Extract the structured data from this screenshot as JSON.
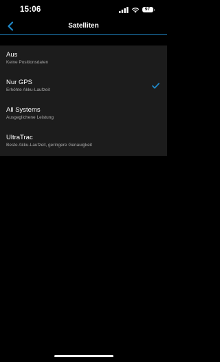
{
  "status_bar": {
    "time": "15:06",
    "battery": "97"
  },
  "nav": {
    "title": "Satelliten",
    "accent_color": "#1f88c8"
  },
  "options": [
    {
      "label": "Aus",
      "description": "Keine Positionsdaten",
      "selected": false
    },
    {
      "label": "Nur GPS",
      "description": "Erhöhte Akku-Laufzeit",
      "selected": true
    },
    {
      "label": "All Systems",
      "description": "Ausgeglichene Leistung",
      "selected": false
    },
    {
      "label": "UltraTrac",
      "description": "Beste Akku-Laufzeit, geringere Genauigkeit",
      "selected": false
    }
  ],
  "icons": {
    "back": "chevron-left-icon",
    "selected": "check-icon"
  }
}
